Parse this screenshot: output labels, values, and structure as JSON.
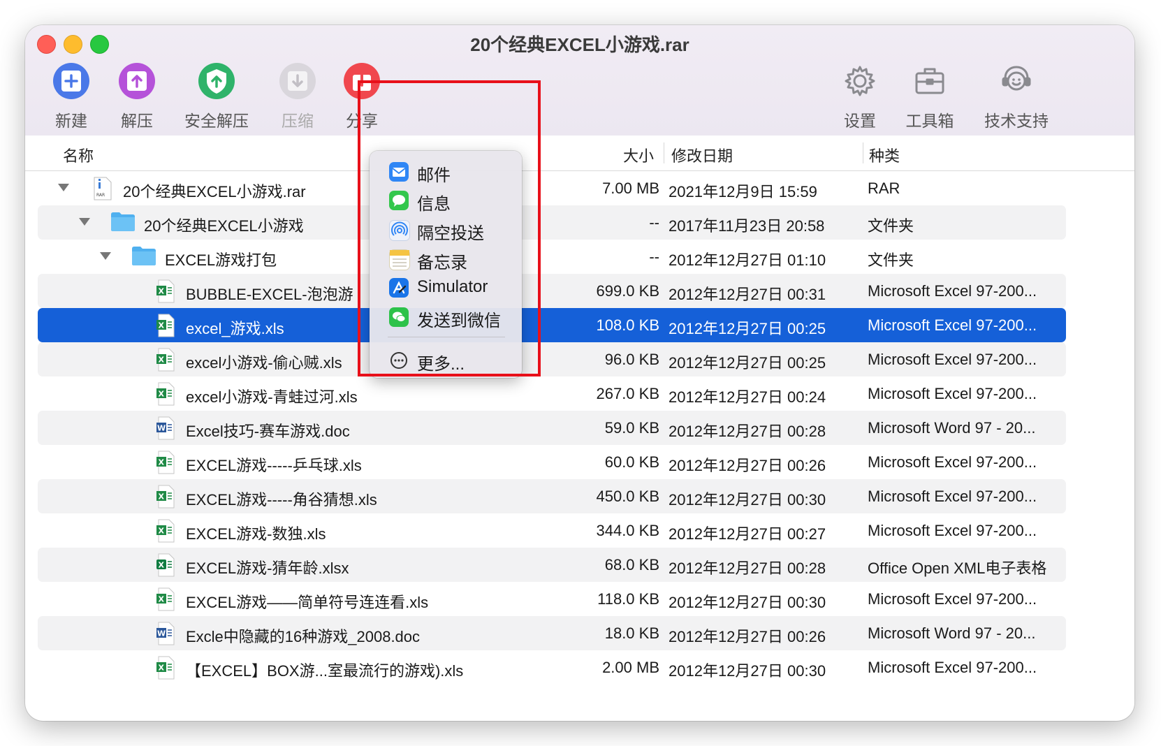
{
  "window": {
    "title": "20个经典EXCEL小游戏.rar"
  },
  "toolbar": {
    "new": "新建",
    "extract": "解压",
    "safe_extract": "安全解压",
    "compress": "压缩",
    "share": "分享",
    "settings": "设置",
    "toolbox": "工具箱",
    "support": "技术支持"
  },
  "columns": {
    "name": "名称",
    "size": "大小",
    "modified": "修改日期",
    "kind": "种类"
  },
  "share_menu": {
    "items": [
      "邮件",
      "信息",
      "隔空投送",
      "备忘录",
      "Simulator",
      "发送到微信"
    ],
    "more": "更多..."
  },
  "files": [
    {
      "name": "20个经典EXCEL小游戏.rar",
      "size": "7.00 MB",
      "date": "2021年12月9日 15:59",
      "kind": "RAR"
    },
    {
      "name": "20个经典EXCEL小游戏",
      "size": "--",
      "date": "2017年11月23日 20:58",
      "kind": "文件夹"
    },
    {
      "name": "EXCEL游戏打包",
      "size": "--",
      "date": "2012年12月27日 01:10",
      "kind": "文件夹"
    },
    {
      "name": "BUBBLE-EXCEL-泡泡游",
      "size": "699.0 KB",
      "date": "2012年12月27日 00:31",
      "kind": "Microsoft Excel 97-200..."
    },
    {
      "name": "excel_游戏.xls",
      "size": "108.0 KB",
      "date": "2012年12月27日 00:25",
      "kind": "Microsoft Excel 97-200..."
    },
    {
      "name": "excel小游戏-偷心贼.xls",
      "size": "96.0 KB",
      "date": "2012年12月27日 00:25",
      "kind": "Microsoft Excel 97-200..."
    },
    {
      "name": "excel小游戏-青蛙过河.xls",
      "size": "267.0 KB",
      "date": "2012年12月27日 00:24",
      "kind": "Microsoft Excel 97-200..."
    },
    {
      "name": "Excel技巧-赛车游戏.doc",
      "size": "59.0 KB",
      "date": "2012年12月27日 00:28",
      "kind": "Microsoft Word 97 - 20..."
    },
    {
      "name": "EXCEL游戏-----乒乓球.xls",
      "size": "60.0 KB",
      "date": "2012年12月27日 00:26",
      "kind": "Microsoft Excel 97-200..."
    },
    {
      "name": "EXCEL游戏-----角谷猜想.xls",
      "size": "450.0 KB",
      "date": "2012年12月27日 00:30",
      "kind": "Microsoft Excel 97-200..."
    },
    {
      "name": "EXCEL游戏-数独.xls",
      "size": "344.0 KB",
      "date": "2012年12月27日 00:27",
      "kind": "Microsoft Excel 97-200..."
    },
    {
      "name": "EXCEL游戏-猜年龄.xlsx",
      "size": "68.0 KB",
      "date": "2012年12月27日 00:28",
      "kind": "Office Open XML电子表格"
    },
    {
      "name": "EXCEL游戏——简单符号连连看.xls",
      "size": "118.0 KB",
      "date": "2012年12月27日 00:30",
      "kind": "Microsoft Excel 97-200..."
    },
    {
      "name": "Excle中隐藏的16种游戏_2008.doc",
      "size": "18.0 KB",
      "date": "2012年12月27日 00:26",
      "kind": "Microsoft Word 97 - 20..."
    },
    {
      "name": "【EXCEL】BOX游...室最流行的游戏).xls",
      "size": "2.00 MB",
      "date": "2012年12月27日 00:30",
      "kind": "Microsoft Excel 97-200..."
    }
  ],
  "colors": {
    "selection": "#1560d8",
    "highlight_box": "#e8101a",
    "share_icon": "#f0474e"
  }
}
